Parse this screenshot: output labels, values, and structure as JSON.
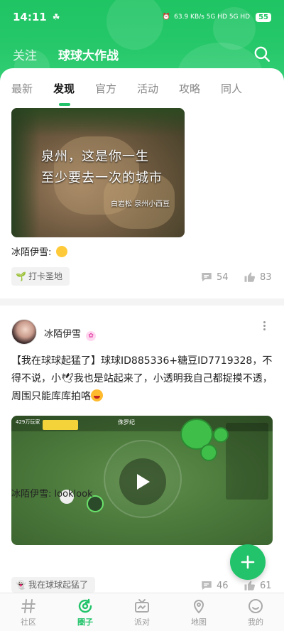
{
  "status_bar": {
    "time": "14:11",
    "right_text": "63.9 KB/s  5G HD  5G HD",
    "battery": "55"
  },
  "top_nav": {
    "follow_label": "关注",
    "title": "球球大作战"
  },
  "tabs": [
    {
      "label": "最新",
      "active": false
    },
    {
      "label": "发现",
      "active": true
    },
    {
      "label": "官方",
      "active": false
    },
    {
      "label": "活动",
      "active": false
    },
    {
      "label": "攻略",
      "active": false
    },
    {
      "label": "同人",
      "active": false
    }
  ],
  "post1": {
    "image_caption_line1": "泉州，这是你一生",
    "image_caption_line2": "至少要去一次的城市",
    "image_caption_credit": "白岩松 泉州小西豆",
    "caption": "冰陌伊雪:",
    "tag": "打卡圣地",
    "comments": "54",
    "likes": "83"
  },
  "post2": {
    "author": "冰陌伊雪",
    "text": "【我在球球起猛了】球球ID885336+糖豆ID7719328，不得不说，小🕊我也是站起来了，小透明我自己都捉摸不透，周围只能库库拍咯",
    "video_hud": "429万玩家",
    "video_hud_center": "侏罗纪",
    "caption": "冰陌伊雪: looklook",
    "tag": "我在球球起猛了",
    "comments": "46",
    "likes": "61"
  },
  "bottom_nav": [
    {
      "label": "社区",
      "icon": "hash-icon",
      "active": false
    },
    {
      "label": "圈子",
      "icon": "circle-refresh-icon",
      "active": true
    },
    {
      "label": "派对",
      "icon": "tv-icon",
      "active": false
    },
    {
      "label": "地图",
      "icon": "map-pin-icon",
      "active": false
    },
    {
      "label": "我的",
      "icon": "smile-icon",
      "active": false
    }
  ],
  "colors": {
    "brand_green": "#22c36a",
    "header_green": "#1fc463"
  }
}
